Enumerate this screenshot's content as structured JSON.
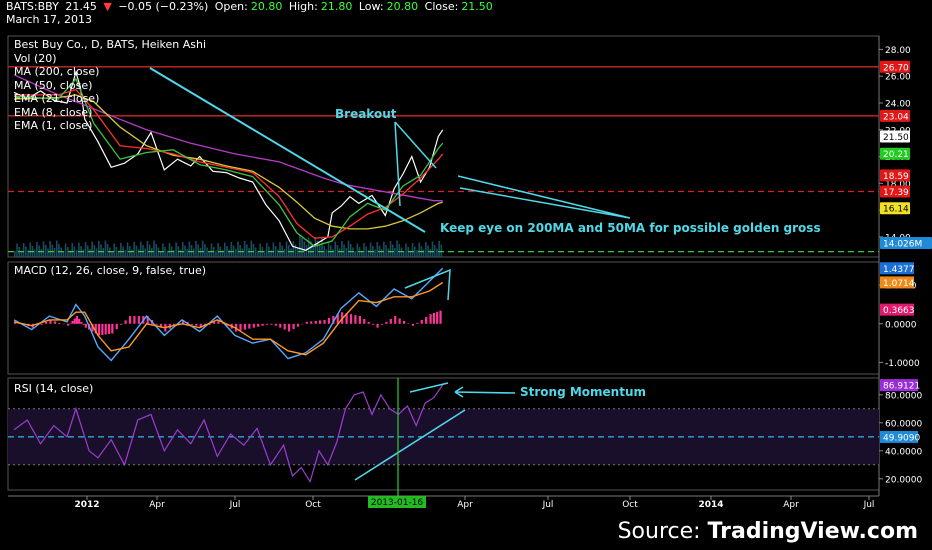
{
  "header": {
    "symbol": "BATS:BBY",
    "last": "21.45",
    "change": "−0.05 (−0.23%)",
    "open_label": "Open:",
    "open": "20.80",
    "high_label": "High:",
    "high": "21.80",
    "low_label": "Low:",
    "low": "20.80",
    "close_label": "Close:",
    "close": "21.50",
    "date": "March 17, 2013"
  },
  "main_title": "Best Buy Co., D, BATS, Heiken Ashi",
  "main_indicators": [
    "Vol (20)",
    "MA (200, close)",
    "MA (50, close)",
    "EMA (21, close)",
    "EMA (8, close)",
    "EMA (1, close)"
  ],
  "macd_title": "MACD (12, 26, close, 9, false, true)",
  "rsi_title": "RSI (14, close)",
  "annotations": {
    "breakout": "Breakout",
    "golden": "Keep eye on 200MA and 50MA for possible golden gross",
    "momentum": "Strong Momentum"
  },
  "source": {
    "prefix": "Source: ",
    "brand": "TradingView.com"
  },
  "colors": {
    "background": "#000000",
    "ma200": "#b43cc8",
    "ma50": "#d8c93a",
    "ema21": "#ff3030",
    "ema8": "#3ec43e",
    "price": "#ffffff",
    "annotation": "#4fd8e8",
    "macd_line": "#55aaff",
    "signal_line": "#ff9922",
    "histogram": "#ff3399",
    "rsi_line": "#9a3ed0",
    "resistance": "#cc2a2a",
    "support": "#33cc33"
  },
  "chart_data": [
    {
      "type": "line",
      "panel": "price",
      "ylim": [
        12.5,
        29.0
      ],
      "y_ticks": [
        "28.00",
        "26.00",
        "24.00",
        "22.00",
        "20.00",
        "18.00",
        "16.00",
        "14.00"
      ],
      "x_ticks": [
        "2012",
        "Apr",
        "Jul",
        "Oct",
        "2013-01-16",
        "Apr",
        "Jul",
        "Oct",
        "2014",
        "Apr",
        "Jul"
      ],
      "price_labels": [
        {
          "text": "26.70",
          "value": 26.7,
          "color": "#e01818"
        },
        {
          "text": "23.04",
          "value": 23.04,
          "color": "#e01818"
        },
        {
          "text": "21.50",
          "value": 21.5,
          "color": "#ffffff"
        },
        {
          "text": "20.21",
          "value": 20.21,
          "color": "#22cc22"
        },
        {
          "text": "18.59",
          "value": 18.59,
          "color": "#e01818"
        },
        {
          "text": "17.39",
          "value": 17.39,
          "color": "#e01818"
        },
        {
          "text": "16.14",
          "value": 16.14,
          "color": "#f2e022"
        },
        {
          "text": "14.026M",
          "value": 13.0,
          "color": "#1f8ad8"
        }
      ],
      "horizontal_levels": [
        {
          "value": 26.7,
          "style": "solid",
          "color": "#cc2a2a"
        },
        {
          "value": 23.04,
          "style": "solid",
          "color": "#cc2a2a"
        },
        {
          "value": 17.39,
          "style": "dashed",
          "color": "#e02020"
        },
        {
          "value": 12.9,
          "style": "dashed",
          "color": "#33cc33"
        }
      ],
      "series": [
        {
          "name": "EMA (1, close)",
          "x": [
            0,
            3,
            6,
            9,
            12,
            14,
            15,
            16,
            19,
            22,
            25,
            28,
            31,
            34,
            37,
            40,
            42,
            45,
            48,
            51,
            54,
            57,
            60,
            63,
            66,
            69,
            71,
            72,
            74,
            76,
            78,
            81,
            84,
            86,
            88,
            90,
            92,
            94,
            96,
            97
          ],
          "values": [
            24.8,
            24.3,
            24.9,
            24.2,
            24.0,
            26.3,
            25.2,
            22.8,
            21.1,
            19.2,
            19.5,
            20.2,
            21.8,
            19.0,
            19.8,
            19.3,
            20.0,
            18.9,
            18.8,
            18.4,
            18.1,
            16.4,
            15.2,
            13.3,
            13.0,
            13.6,
            14.0,
            15.8,
            16.3,
            17.0,
            16.5,
            17.1,
            15.6,
            17.6,
            18.7,
            20.0,
            18.1,
            19.2,
            21.5,
            22.0
          ]
        },
        {
          "name": "MA (200, close)",
          "x": [
            0,
            10,
            14,
            20,
            30,
            40,
            50,
            60,
            70,
            75,
            80,
            85,
            90,
            95,
            97
          ],
          "values": [
            26.1,
            24.6,
            24.1,
            23.3,
            22.0,
            21.0,
            20.2,
            19.6,
            18.4,
            17.9,
            17.6,
            17.3,
            17.0,
            16.7,
            16.7
          ]
        },
        {
          "name": "MA (50, close)",
          "x": [
            0,
            10,
            14,
            18,
            24,
            30,
            36,
            42,
            48,
            54,
            60,
            64,
            68,
            72,
            76,
            80,
            84,
            88,
            92,
            96,
            97
          ],
          "values": [
            24.3,
            24.4,
            24.6,
            24.1,
            22.2,
            20.8,
            20.1,
            19.8,
            19.3,
            18.9,
            17.7,
            16.6,
            15.4,
            14.8,
            14.6,
            14.6,
            14.8,
            15.2,
            15.8,
            16.5,
            16.6
          ]
        },
        {
          "name": "EMA (21, close)",
          "x": [
            0,
            10,
            14,
            18,
            24,
            30,
            36,
            42,
            48,
            54,
            60,
            64,
            68,
            72,
            76,
            80,
            84,
            88,
            92,
            96,
            97
          ],
          "values": [
            24.6,
            24.6,
            25.0,
            23.5,
            20.8,
            20.6,
            20.2,
            19.6,
            19.2,
            18.8,
            17.0,
            15.0,
            13.9,
            14.0,
            14.8,
            15.7,
            16.2,
            17.2,
            18.4,
            19.8,
            20.2
          ]
        },
        {
          "name": "EMA (8, close)",
          "x": [
            0,
            10,
            14,
            18,
            24,
            30,
            36,
            42,
            48,
            54,
            60,
            64,
            68,
            72,
            76,
            80,
            84,
            88,
            92,
            96,
            97
          ],
          "values": [
            24.5,
            24.3,
            25.8,
            22.5,
            19.8,
            20.3,
            20.5,
            19.4,
            19.0,
            18.5,
            16.4,
            14.3,
            13.3,
            13.7,
            15.5,
            16.5,
            16.0,
            17.8,
            18.6,
            20.6,
            21.0
          ]
        }
      ]
    },
    {
      "type": "line",
      "panel": "macd",
      "ylim": [
        -1.3,
        1.6
      ],
      "y_ticks": [
        "1.0000",
        "0.0000",
        "-1.0000"
      ],
      "value_labels": [
        {
          "text": "1.4377",
          "value": 1.4377,
          "color": "#1a6fd6"
        },
        {
          "text": "1.0714",
          "value": 1.0714,
          "color": "#ef8a1a"
        },
        {
          "text": "0.3663",
          "value": 0.3663,
          "color": "#e01a6e"
        }
      ],
      "series": [
        {
          "name": "MACD",
          "x": [
            0,
            4,
            8,
            12,
            14,
            16,
            19,
            22,
            26,
            30,
            34,
            38,
            42,
            46,
            50,
            54,
            58,
            62,
            66,
            70,
            74,
            78,
            82,
            86,
            90,
            94,
            97
          ],
          "values": [
            0.1,
            -0.15,
            0.2,
            0.05,
            0.5,
            0.2,
            -0.6,
            -0.95,
            -0.4,
            0.2,
            -0.3,
            0.1,
            -0.2,
            0.2,
            -0.3,
            -0.5,
            -0.4,
            -0.9,
            -0.75,
            -0.4,
            0.4,
            0.8,
            0.45,
            0.9,
            0.65,
            1.1,
            1.44
          ]
        },
        {
          "name": "Signal",
          "x": [
            0,
            4,
            8,
            12,
            14,
            16,
            19,
            22,
            26,
            30,
            34,
            38,
            42,
            46,
            50,
            54,
            58,
            62,
            66,
            70,
            74,
            78,
            82,
            86,
            90,
            94,
            97
          ],
          "values": [
            0.05,
            -0.05,
            0.1,
            0.1,
            0.3,
            0.3,
            -0.3,
            -0.7,
            -0.6,
            0.0,
            -0.1,
            0.0,
            -0.1,
            0.1,
            -0.1,
            -0.4,
            -0.4,
            -0.7,
            -0.8,
            -0.5,
            0.1,
            0.6,
            0.55,
            0.7,
            0.7,
            0.85,
            1.07
          ]
        },
        {
          "name": "Histogram",
          "x": [
            0,
            4,
            8,
            12,
            14,
            16,
            19,
            22,
            26,
            30,
            34,
            38,
            42,
            46,
            50,
            54,
            58,
            62,
            66,
            70,
            74,
            78,
            82,
            86,
            90,
            94,
            97
          ],
          "values": [
            0.05,
            -0.1,
            0.1,
            -0.05,
            0.2,
            -0.1,
            -0.3,
            -0.25,
            0.2,
            0.2,
            -0.2,
            0.1,
            -0.1,
            0.1,
            -0.2,
            -0.1,
            0.0,
            -0.2,
            0.05,
            0.1,
            0.3,
            0.2,
            -0.1,
            0.2,
            -0.05,
            0.25,
            0.37
          ]
        }
      ]
    },
    {
      "type": "line",
      "panel": "rsi",
      "ylim": [
        12,
        92
      ],
      "y_ticks": [
        "80.0000",
        "60.0000",
        "40.0000",
        "20.0000"
      ],
      "value_labels": [
        {
          "text": "86.9121",
          "value": 86.9121,
          "color": "#9a2dd8"
        },
        {
          "text": "49.9090",
          "value": 49.909,
          "color": "#1f8ad8"
        }
      ],
      "reference_levels": [
        70,
        50,
        30
      ],
      "series": [
        {
          "name": "RSI (14, close)",
          "x": [
            0,
            3,
            6,
            9,
            12,
            14,
            15,
            17,
            19,
            22,
            25,
            28,
            31,
            34,
            37,
            40,
            43,
            46,
            49,
            52,
            55,
            58,
            61,
            63,
            65,
            67,
            69,
            71,
            73,
            75,
            77,
            79,
            81,
            83,
            85,
            87,
            89,
            91,
            93,
            95,
            97
          ],
          "values": [
            55,
            62,
            45,
            58,
            50,
            70,
            60,
            40,
            35,
            48,
            30,
            62,
            66,
            40,
            55,
            45,
            62,
            36,
            52,
            44,
            56,
            30,
            44,
            22,
            28,
            18,
            40,
            30,
            46,
            70,
            80,
            82,
            66,
            80,
            70,
            66,
            72,
            58,
            74,
            78,
            87
          ]
        }
      ]
    }
  ]
}
